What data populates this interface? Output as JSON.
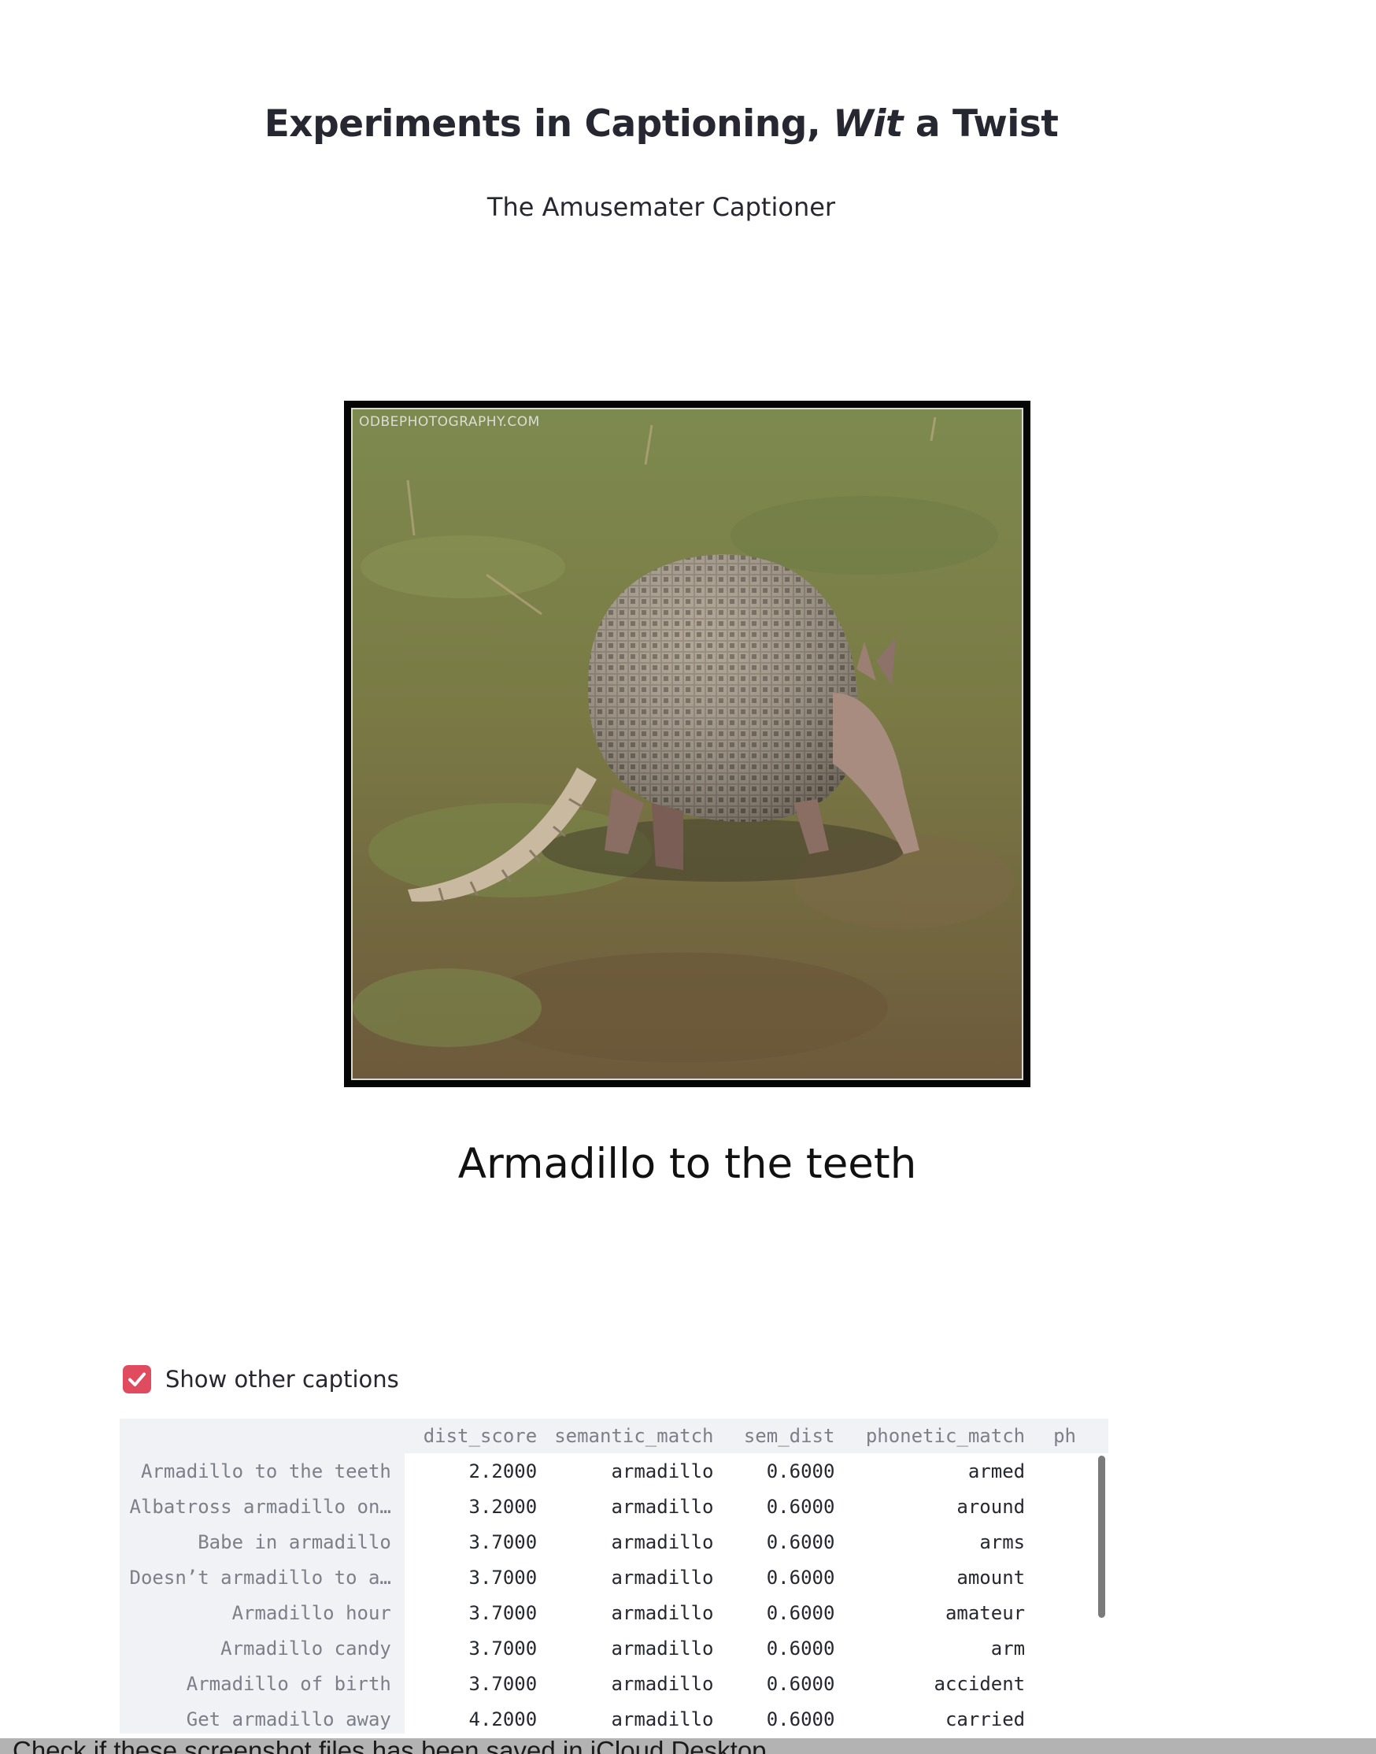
{
  "header": {
    "title_before": "Experiments in Captioning, ",
    "title_italic": "Wit",
    "title_after": " a Twist",
    "subtitle": "The Amusemater Captioner"
  },
  "figure": {
    "watermark": "ODBEPHOTOGRAPHY.COM",
    "caption": "Armadillo to the teeth"
  },
  "controls": {
    "show_other_captions_label": "Show other captions",
    "show_other_captions_checked": true
  },
  "table": {
    "columns": [
      "dist_score",
      "semantic_match",
      "sem_dist",
      "phonetic_match",
      "ph"
    ],
    "rows": [
      {
        "index": "Armadillo to the teeth",
        "cells": [
          "2.2000",
          "armadillo",
          "0.6000",
          "armed",
          ""
        ]
      },
      {
        "index": "Albatross armadillo on…",
        "cells": [
          "3.2000",
          "armadillo",
          "0.6000",
          "around",
          ""
        ]
      },
      {
        "index": "Babe in armadillo",
        "cells": [
          "3.7000",
          "armadillo",
          "0.6000",
          "arms",
          ""
        ]
      },
      {
        "index": "Doesn’t armadillo to a…",
        "cells": [
          "3.7000",
          "armadillo",
          "0.6000",
          "amount",
          ""
        ]
      },
      {
        "index": "Armadillo hour",
        "cells": [
          "3.7000",
          "armadillo",
          "0.6000",
          "amateur",
          ""
        ]
      },
      {
        "index": "Armadillo candy",
        "cells": [
          "3.7000",
          "armadillo",
          "0.6000",
          "arm",
          ""
        ]
      },
      {
        "index": "Armadillo of birth",
        "cells": [
          "3.7000",
          "armadillo",
          "0.6000",
          "accident",
          ""
        ]
      },
      {
        "index": "Get armadillo away",
        "cells": [
          "4.2000",
          "armadillo",
          "0.6000",
          "carried",
          ""
        ]
      }
    ]
  },
  "notification": {
    "text": "Check if these screenshot files has been saved in iCloud Desktop"
  },
  "colors": {
    "accent": "#e04b5f",
    "table_header_bg": "#f0f2f6",
    "text": "#262730"
  }
}
